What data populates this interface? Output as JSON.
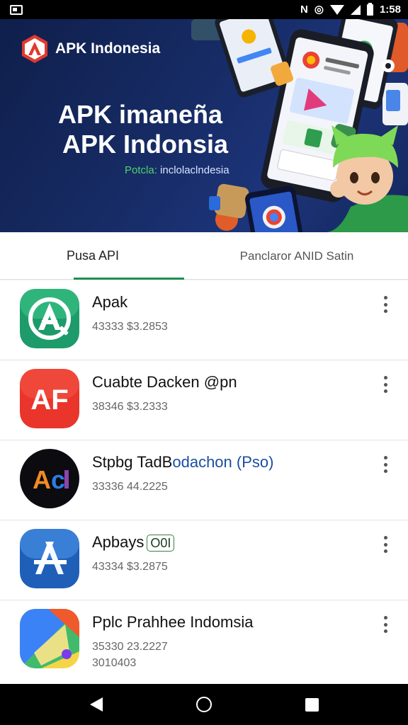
{
  "status_bar": {
    "time": "1:58",
    "icons": [
      "notification-icon",
      "nfc-icon",
      "vibrate-icon",
      "wifi-icon",
      "signal-icon",
      "battery-icon"
    ]
  },
  "banner": {
    "logo_text": "APK Indonesia",
    "title_line1": "APK  imaneña",
    "title_line2": "APK Indonsia",
    "subtitle_green": "Potcla:",
    "subtitle_rest": " inclolaclndesia",
    "colors": {
      "background": "#15285d",
      "accent": "#4fd26b"
    }
  },
  "tabs": [
    {
      "label": "Pusa API",
      "active": true
    },
    {
      "label": "Panclaror ANID Satin",
      "active": false
    }
  ],
  "apps": [
    {
      "name": "Apak",
      "name_tag": "",
      "name_blue": "",
      "meta": "43333 $3.2853",
      "meta2": "",
      "icon": "apk-compass-icon"
    },
    {
      "name": "Cuabte Dacken",
      "name_tag": "",
      "name_blue": "",
      "name_suffix": "@pn",
      "meta": "38346 $3.2333",
      "meta2": "",
      "icon": "af-icon"
    },
    {
      "name": "Stpbg TadB",
      "name_tag": "",
      "name_blue": "odachon (Pso)",
      "meta": "33336 44.2225",
      "meta2": "",
      "icon": "adobe-ai-icon"
    },
    {
      "name": "Apbays",
      "name_tag": "O0I",
      "name_blue": "",
      "meta": "43334 $3.2875",
      "meta2": "",
      "icon": "app-store-icon"
    },
    {
      "name": "Pplc Prahhee Indomsia",
      "name_tag": "",
      "name_blue": "",
      "meta": "35330 23.2227",
      "meta2": "3010403",
      "icon": "google-play-icon"
    }
  ],
  "nav": {
    "icons": [
      "back-icon",
      "home-icon",
      "recents-icon"
    ]
  }
}
